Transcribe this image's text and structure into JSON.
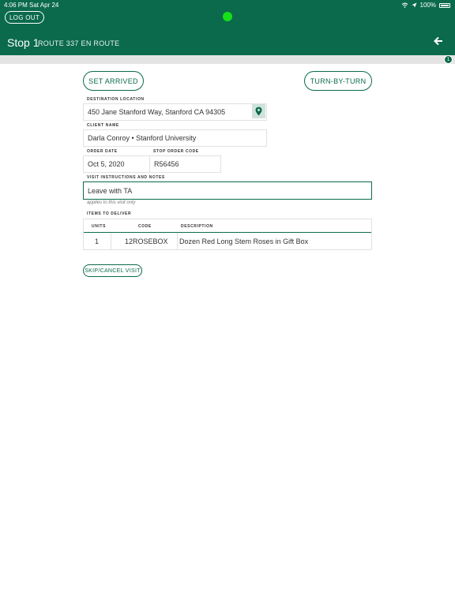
{
  "status_bar": {
    "time": "4:06 PM",
    "date": "Sat Apr 24",
    "battery": "100%"
  },
  "header": {
    "logout_label": "LOG OUT",
    "stop_title": "Stop 1",
    "route_text": "ROUTE 337 EN ROUTE",
    "progress_count": "1"
  },
  "actions": {
    "set_arrived_label": "SET ARRIVED",
    "turn_by_turn_label": "TURN-BY-TURN",
    "skip_label": "SKIP/CANCEL VISIT"
  },
  "form": {
    "destination_label": "DESTINATION LOCATION",
    "destination_value": "450 Jane Stanford Way, Stanford CA 94305",
    "client_label": "CLIENT NAME",
    "client_value": "Darla Conroy • Stanford University",
    "order_date_label": "ORDER DATE",
    "order_date_value": "Oct 5, 2020",
    "stop_code_label": "STOP ORDER CODE",
    "stop_code_value": "R56456",
    "instructions_label": "VISIT INSTRUCTIONS AND NOTES",
    "instructions_value": "Leave with TA",
    "instructions_hint": "applies to this visit only"
  },
  "items": {
    "section_label": "ITEMS TO DELIVER",
    "columns": [
      "UNITS",
      "CODE",
      "DESCRIPTION"
    ],
    "rows": [
      {
        "units": "1",
        "code": "12ROSEBOX",
        "description": "Dozen Red Long Stem Roses in Gift Box"
      }
    ]
  },
  "colors": {
    "brand": "#0b6a4c",
    "status_dot": "#16e016",
    "progress_strip": "#e4e4e4"
  },
  "icons": {
    "back": "arrow-left-icon",
    "pin": "map-pin-icon",
    "wifi": "wifi-icon",
    "location": "location-arrow-icon",
    "battery": "battery-icon"
  }
}
